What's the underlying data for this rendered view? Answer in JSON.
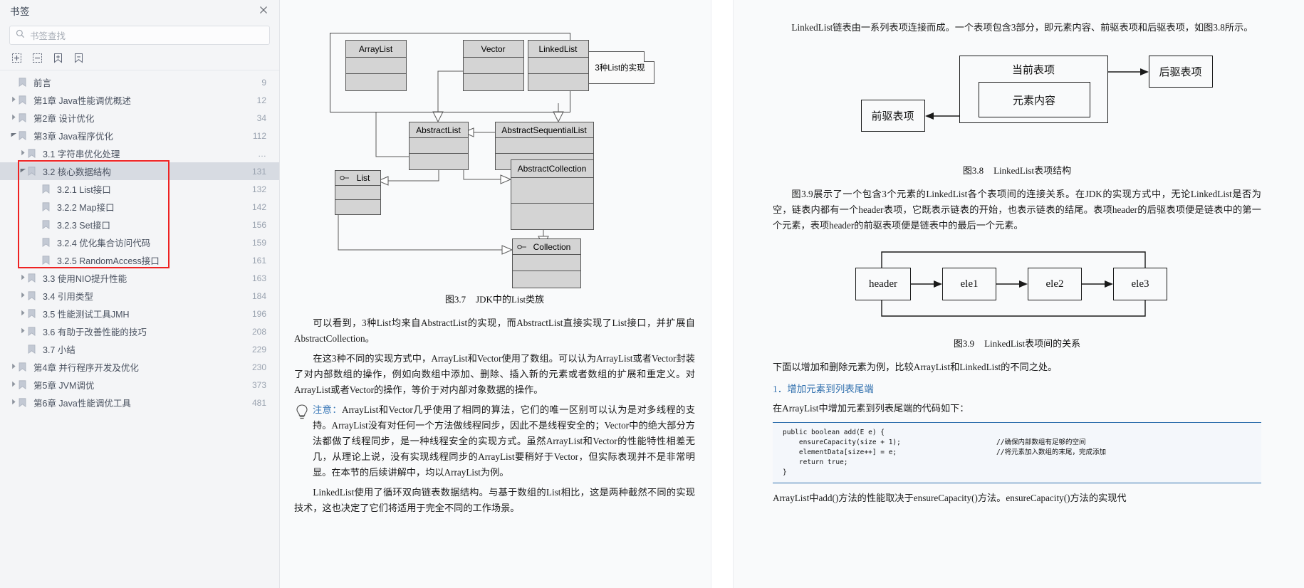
{
  "sidebar": {
    "title": "书签",
    "close_icon": "close-icon",
    "search": {
      "placeholder": "书签查找",
      "value": "",
      "icon": "search-icon"
    },
    "toolbar": [
      {
        "name": "expand-all-icon",
        "label": "展开全部"
      },
      {
        "name": "collapse-all-icon",
        "label": "折叠全部"
      },
      {
        "name": "add-bookmark-icon",
        "label": "添加书签"
      },
      {
        "name": "remove-bookmark-icon",
        "label": "删除书签"
      }
    ],
    "items": [
      {
        "label": "前言",
        "page": "9",
        "level": 0,
        "twisty": "none",
        "selected": false
      },
      {
        "label": "第1章  Java性能调优概述",
        "page": "12",
        "level": 0,
        "twisty": "closed",
        "selected": false
      },
      {
        "label": "第2章  设计优化",
        "page": "34",
        "level": 0,
        "twisty": "closed",
        "selected": false
      },
      {
        "label": "第3章  Java程序优化",
        "page": "112",
        "level": 0,
        "twisty": "open",
        "selected": false
      },
      {
        "label": "3.1  字符串优化处理",
        "page": "…",
        "level": 1,
        "twisty": "closed",
        "selected": false
      },
      {
        "label": "3.2  核心数据结构",
        "page": "131",
        "level": 1,
        "twisty": "open",
        "selected": true
      },
      {
        "label": "3.2.1  List接口",
        "page": "132",
        "level": 2,
        "twisty": "none",
        "selected": false
      },
      {
        "label": "3.2.2  Map接口",
        "page": "142",
        "level": 2,
        "twisty": "none",
        "selected": false
      },
      {
        "label": "3.2.3  Set接口",
        "page": "156",
        "level": 2,
        "twisty": "none",
        "selected": false
      },
      {
        "label": "3.2.4  优化集合访问代码",
        "page": "159",
        "level": 2,
        "twisty": "none",
        "selected": false
      },
      {
        "label": "3.2.5  RandomAccess接口",
        "page": "161",
        "level": 2,
        "twisty": "none",
        "selected": false
      },
      {
        "label": "3.3  使用NIO提升性能",
        "page": "163",
        "level": 1,
        "twisty": "closed",
        "selected": false
      },
      {
        "label": "3.4  引用类型",
        "page": "184",
        "level": 1,
        "twisty": "closed",
        "selected": false
      },
      {
        "label": "3.5  性能测试工具JMH",
        "page": "196",
        "level": 1,
        "twisty": "closed",
        "selected": false
      },
      {
        "label": "3.6  有助于改善性能的技巧",
        "page": "208",
        "level": 1,
        "twisty": "closed",
        "selected": false
      },
      {
        "label": "3.7  小结",
        "page": "229",
        "level": 1,
        "twisty": "none",
        "selected": false
      },
      {
        "label": "第4章  并行程序开发及优化",
        "page": "230",
        "level": 0,
        "twisty": "closed",
        "selected": false
      },
      {
        "label": "第5章  JVM调优",
        "page": "373",
        "level": 0,
        "twisty": "closed",
        "selected": false
      },
      {
        "label": "第6章  Java性能调优工具",
        "page": "481",
        "level": 0,
        "twisty": "closed",
        "selected": false
      }
    ],
    "highlight_color": "#ee2222",
    "selected_color": "#d7dbe2"
  },
  "middle_page": {
    "uml": {
      "note_label": "3种List的实现",
      "classes": [
        {
          "id": "arraylist",
          "name": "ArrayList"
        },
        {
          "id": "vector",
          "name": "Vector"
        },
        {
          "id": "linkedlist",
          "name": "LinkedList"
        },
        {
          "id": "abstractlist",
          "name": "AbstractList"
        },
        {
          "id": "abstractsequentiallist",
          "name": "AbstractSequentialList"
        },
        {
          "id": "abstractcollection",
          "name": "AbstractCollection"
        },
        {
          "id": "list",
          "name": "List",
          "interface": true
        },
        {
          "id": "collection",
          "name": "Collection",
          "interface": true
        }
      ]
    },
    "fig_caption_num": "图3.7",
    "fig_caption_text": "JDK中的List类族",
    "paragraphs": [
      "可以看到，3种List均来自AbstractList的实现，而AbstractList直接实现了List接口，并扩展自AbstractCollection。",
      "在这3种不同的实现方式中，ArrayList和Vector使用了数组。可以认为ArrayList或者Vector封装了对内部数组的操作，例如向数组中添加、删除、插入新的元素或者数组的扩展和重定义。对ArrayList或者Vector的操作，等价于对内部对象数据的操作。"
    ],
    "tip_label": "注意：",
    "tip_text": "ArrayList和Vector几乎使用了相同的算法，它们的唯一区别可以认为是对多线程的支持。ArrayList没有对任何一个方法做线程同步，因此不是线程安全的；Vector中的绝大部分方法都做了线程同步，是一种线程安全的实现方式。虽然ArrayList和Vector的性能特性相差无几，从理论上说，没有实现线程同步的ArrayList要稍好于Vector，但实际表现并不是非常明显。在本节的后续讲解中，均以ArrayList为例。",
    "last_paragraph": "LinkedList使用了循环双向链表数据结构。与基于数组的List相比，这是两种截然不同的实现技术，这也决定了它们将适用于完全不同的工作场景。"
  },
  "right_page": {
    "intro_paragraph": "LinkedList链表由一系列表项连接而成。一个表项包含3部分，即元素内容、前驱表项和后驱表项，如图3.8所示。",
    "fig38": {
      "current": "当前表项",
      "content": "元素内容",
      "prev": "前驱表项",
      "next": "后驱表项",
      "caption_num": "图3.8",
      "caption_text": "LinkedList表项结构"
    },
    "paragraph2": "图3.9展示了一个包含3个元素的LinkedList各个表项间的连接关系。在JDK的实现方式中，无论LinkedList是否为空，链表内都有一个header表项，它既表示链表的开始，也表示链表的结尾。表项header的后驱表项便是链表中的第一个元素，表项header的前驱表项便是链表中的最后一个元素。",
    "fig39": {
      "nodes": [
        "header",
        "ele1",
        "ele2",
        "ele3"
      ],
      "caption_num": "图3.9",
      "caption_text": "LinkedList表项间的关系"
    },
    "paragraph3": "下面以增加和删除元素为例，比较ArrayList和LinkedList的不同之处。",
    "subheading": "1．增加元素到列表尾端",
    "paragraph4": "在ArrayList中增加元素到列表尾端的代码如下：",
    "code_lines": [
      {
        "code": "public boolean add(E e) {",
        "comment": ""
      },
      {
        "code": "    ensureCapacity(size + 1);",
        "comment": "//确保内部数组有足够的空间"
      },
      {
        "code": "    elementData[size++] = e;",
        "comment": "//将元素加入数组的末尾，完成添加"
      },
      {
        "code": "    return true;",
        "comment": ""
      },
      {
        "code": "}",
        "comment": ""
      }
    ],
    "paragraph5": "ArrayList中add()方法的性能取决于ensureCapacity()方法。ensureCapacity()方法的实现代"
  }
}
